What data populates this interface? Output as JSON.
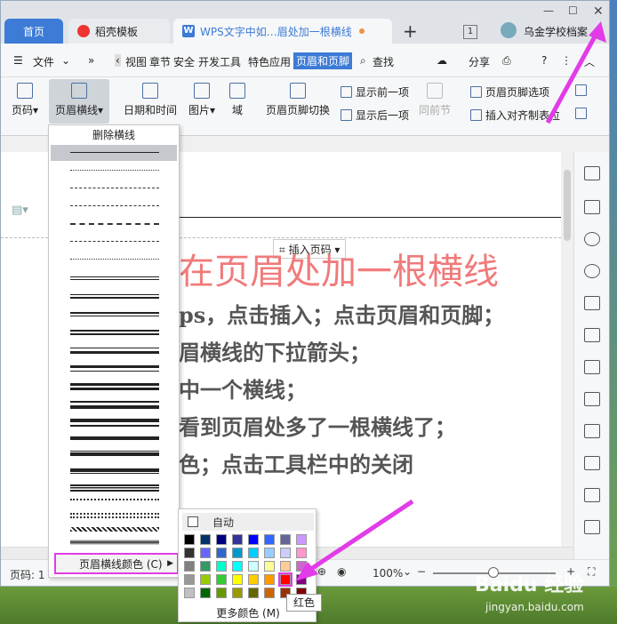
{
  "tabs": {
    "home": "首页",
    "daoke": "稻壳模板",
    "doc": "WPS文字中如…眉处加一根横线",
    "badge": "1",
    "user": "乌金学校档案"
  },
  "menu": {
    "file": "文件",
    "items": [
      "视图",
      "章节",
      "安全",
      "开发工具",
      "特色应用"
    ],
    "active": "页眉和页脚",
    "find": "查找",
    "share": "分享",
    "help": "?"
  },
  "ribbon": {
    "page_num": "页码",
    "header_line": "页眉横线",
    "datetime": "日期和时间",
    "picture": "图片",
    "field": "域",
    "switch": "页眉页脚切换",
    "show_prev": "显示前一项",
    "show_next": "显示后一项",
    "same_prev": "同前节",
    "hf_options": "页眉页脚选项",
    "insert_tab": "插入对齐制表位"
  },
  "document": {
    "insert_page_num": "插入页码",
    "title": "在页眉处加一根横线",
    "lines": [
      "ps，点击插入；点击页眉和页脚；",
      "眉横线的下拉箭头；",
      "中一个横线；",
      "看到页眉处多了一根横线了；",
      "色；点击工具栏中的关闭"
    ]
  },
  "status": {
    "page": "页码: 1",
    "zoom": "100%"
  },
  "dropdown": {
    "delete_line": "删除横线",
    "line_color": "页眉横线颜色 (C)"
  },
  "palette": {
    "auto": "自动",
    "more": "更多颜色 (M)",
    "tooltip": "红色",
    "colors": [
      [
        "#000000",
        "#003366",
        "#000080",
        "#333399",
        "#0000ff",
        "#3366ff",
        "#666699",
        "#cc99ff"
      ],
      [
        "#333333",
        "#6666ff",
        "#3366cc",
        "#0099cc",
        "#00ccff",
        "#99ccff",
        "#ccccff",
        "#ff99cc"
      ],
      [
        "#808080",
        "#339966",
        "#00ffcc",
        "#00ffff",
        "#ccffff",
        "#ffff99",
        "#ffcc99",
        "#cc66cc"
      ],
      [
        "#999999",
        "#99cc00",
        "#33cc33",
        "#ffff00",
        "#ffcc00",
        "#ff9900",
        "#ff0000",
        "#800080"
      ],
      [
        "#c0c0c0",
        "#006600",
        "#669900",
        "#999900",
        "#666600",
        "#cc6600",
        "#993300",
        "#800000"
      ]
    ]
  },
  "watermark": {
    "brand": "Baidu 经验",
    "url": "jingyan.baidu.com"
  }
}
